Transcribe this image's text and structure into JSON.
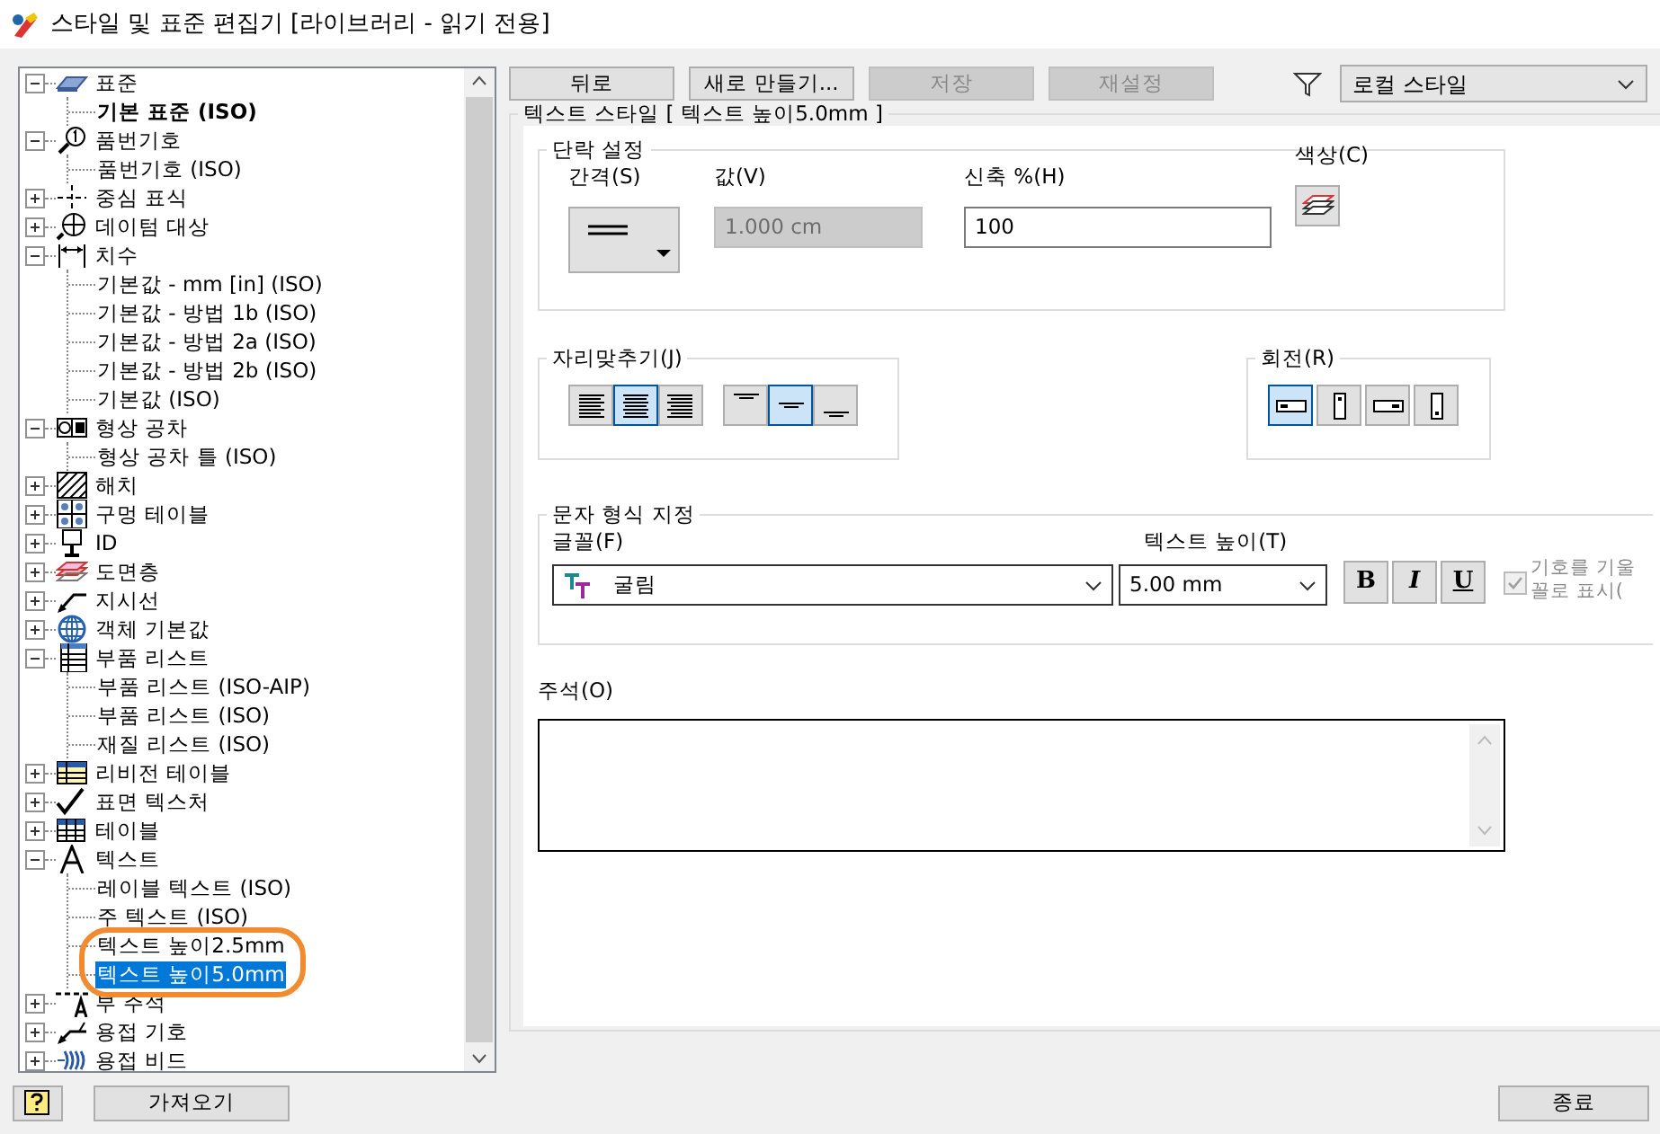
{
  "window": {
    "title": "스타일 및 표준 편집기 [라이브러리 - 읽기 전용]"
  },
  "tree": {
    "items": [
      {
        "label": "표준",
        "expanded": true,
        "selected": false,
        "children": [
          {
            "label": "기본 표준 (ISO)",
            "active": true,
            "selected": false
          }
        ]
      },
      {
        "label": "품번기호",
        "expanded": true,
        "selected": false,
        "children": [
          {
            "label": "품번기호 (ISO)",
            "active": false,
            "selected": false
          }
        ]
      },
      {
        "label": "중심 표식",
        "expanded": false,
        "selected": false
      },
      {
        "label": "데이텀 대상",
        "expanded": false,
        "selected": false
      },
      {
        "label": "치수",
        "expanded": true,
        "selected": false,
        "children": [
          {
            "label": "기본값 - mm [in] (ISO)",
            "active": false,
            "selected": false
          },
          {
            "label": "기본값 - 방법 1b (ISO)",
            "active": false,
            "selected": false
          },
          {
            "label": "기본값 - 방법 2a (ISO)",
            "active": false,
            "selected": false
          },
          {
            "label": "기본값 - 방법 2b (ISO)",
            "active": false,
            "selected": false
          },
          {
            "label": "기본값 (ISO)",
            "active": false,
            "selected": false
          }
        ]
      },
      {
        "label": "형상 공차",
        "expanded": true,
        "selected": false,
        "children": [
          {
            "label": "형상 공차 틀 (ISO)",
            "active": false,
            "selected": false
          }
        ]
      },
      {
        "label": "해치",
        "expanded": false,
        "selected": false
      },
      {
        "label": "구멍 테이블",
        "expanded": false,
        "selected": false
      },
      {
        "label": "ID",
        "expanded": false,
        "selected": false
      },
      {
        "label": "도면층",
        "expanded": false,
        "selected": false
      },
      {
        "label": "지시선",
        "expanded": false,
        "selected": false
      },
      {
        "label": "객체 기본값",
        "expanded": false,
        "selected": false
      },
      {
        "label": "부품 리스트",
        "expanded": true,
        "selected": false,
        "children": [
          {
            "label": "부품 리스트 (ISO-AIP)",
            "active": false,
            "selected": false
          },
          {
            "label": "부품 리스트 (ISO)",
            "active": false,
            "selected": false
          },
          {
            "label": "재질 리스트 (ISO)",
            "active": false,
            "selected": false
          }
        ]
      },
      {
        "label": "리비전 테이블",
        "expanded": false,
        "selected": false
      },
      {
        "label": "표면 텍스처",
        "expanded": false,
        "selected": false
      },
      {
        "label": "테이블",
        "expanded": false,
        "selected": false
      },
      {
        "label": "텍스트",
        "expanded": true,
        "selected": false,
        "children": [
          {
            "label": "레이블 텍스트 (ISO)",
            "active": false,
            "selected": false,
            "circled": false
          },
          {
            "label": "주 텍스트 (ISO)",
            "active": false,
            "selected": false,
            "circled": false
          },
          {
            "label": "텍스트 높이2.5mm",
            "active": false,
            "selected": false,
            "circled": true
          },
          {
            "label": "텍스트 높이5.0mm",
            "active": false,
            "selected": true,
            "circled": true
          }
        ]
      },
      {
        "label": "부 주석",
        "expanded": false,
        "selected": false
      },
      {
        "label": "용접 기호",
        "expanded": false,
        "selected": false
      },
      {
        "label": "용접 비드",
        "expanded": false,
        "selected": false
      }
    ]
  },
  "toolbar": {
    "buttons": [
      {
        "label": "뒤로",
        "disabled": false
      },
      {
        "label": "새로 만들기...",
        "disabled": false
      },
      {
        "label": "저장",
        "disabled": true
      },
      {
        "label": "재설정",
        "disabled": true
      }
    ],
    "filter": "로컬 스타일"
  },
  "style_panel": {
    "title": "텍스트 스타일 [ 텍스트 높이5.0mm ]",
    "paragraph": {
      "title": "단락 설정",
      "spacing_label": "간격(S)",
      "value_label": "값(V)",
      "value": "1.000 cm",
      "value_disabled": true,
      "stretch_label": "신축 %(H)",
      "stretch": "100",
      "color_label": "색상(C)"
    },
    "justification": {
      "title": "자리맞추기(J)",
      "horizontal": [
        {
          "selected": false
        },
        {
          "selected": true
        },
        {
          "selected": false
        }
      ],
      "vertical": [
        {
          "selected": false
        },
        {
          "selected": true
        },
        {
          "selected": false
        }
      ]
    },
    "rotation": {
      "title": "회전(R)",
      "options": [
        {
          "selected": true
        },
        {
          "selected": false
        },
        {
          "selected": false
        },
        {
          "selected": false
        }
      ]
    },
    "format": {
      "title": "문자 형식 지정",
      "font_label": "글꼴(F)",
      "font": "굴림",
      "height_label": "텍스트 높이(T)",
      "height": "5.00 mm",
      "styles": [
        {
          "kind": "bold",
          "label": "B",
          "pressed": false
        },
        {
          "kind": "italic",
          "label": "I",
          "pressed": false
        },
        {
          "kind": "underline",
          "label": "U",
          "pressed": false
        }
      ],
      "checkbox": {
        "lines": [
          "기호를 기울",
          "꼴로 표시("
        ],
        "checked": true,
        "disabled": true
      }
    },
    "note": {
      "label": "주석(O)"
    }
  },
  "footer": {
    "import_button": "가져오기",
    "close_button": "종료"
  }
}
